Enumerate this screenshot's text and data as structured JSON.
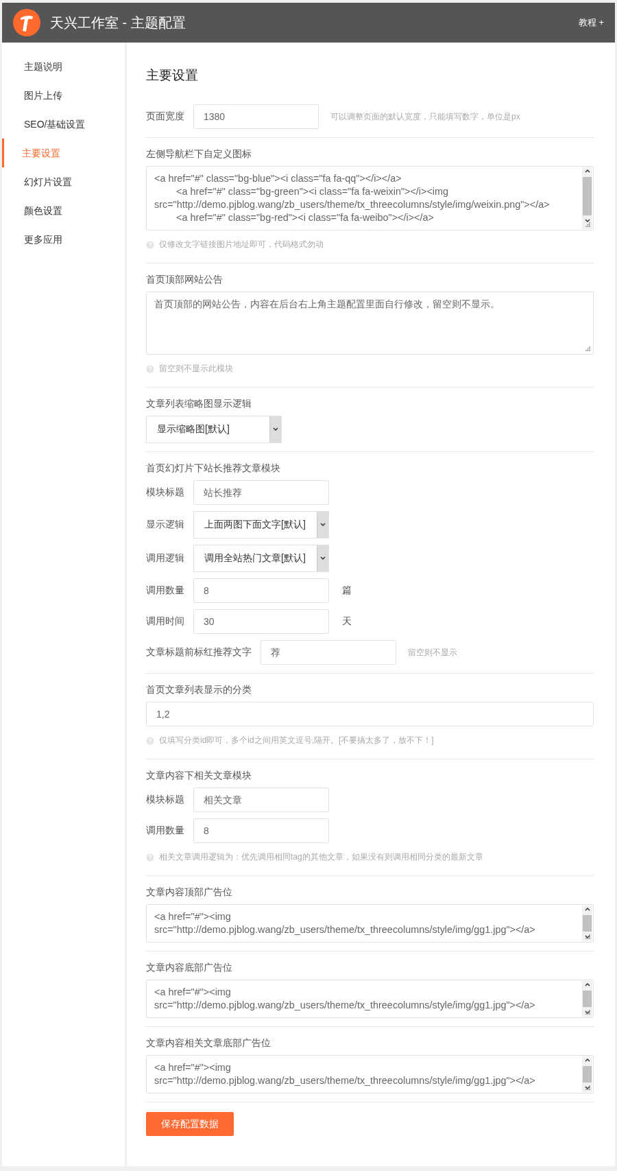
{
  "header": {
    "title": "天兴工作室 - 主题配置",
    "link": "教程 +"
  },
  "sidebar": {
    "items": [
      {
        "label": "主题说明",
        "selected": false
      },
      {
        "label": "图片上传",
        "selected": false
      },
      {
        "label": "SEO/基础设置",
        "selected": false
      },
      {
        "label": "主要设置",
        "selected": true
      },
      {
        "label": "幻灯片设置",
        "selected": false
      },
      {
        "label": "颜色设置",
        "selected": false
      },
      {
        "label": "更多应用",
        "selected": false
      }
    ]
  },
  "page_title": "主要设置",
  "sections": [
    {
      "kind": "inline",
      "label": "页面宽度",
      "value": "1380",
      "hint": "可以调整页面的默认宽度，只能填写数字，单位是px"
    },
    {
      "kind": "textarea",
      "label": "左侧导航栏下自定义图标",
      "value": "<a href=\"#\" class=\"bg-blue\"><i class=\"fa fa-qq\"></i></a>\n        <a href=\"#\" class=\"bg-green\"><i class=\"fa fa-weixin\"></i><img src=\"http://demo.pjblog.wang/zb_users/theme/tx_threecolumns/style/img/weixin.png\"></a>\n        <a href=\"#\" class=\"bg-red\"><i class=\"fa fa-weibo\"></i></a>",
      "scrollable": true,
      "help": "仅修改文字链接图片地址即可，代码格式勿动"
    },
    {
      "kind": "textarea",
      "label": "首页顶部网站公告",
      "value": "首页顶部的网站公告，内容在后台右上角主题配置里面自行修改，留空则不显示。",
      "scrollable": false,
      "help": "留空则不显示此模块"
    },
    {
      "kind": "select",
      "label": "文章列表缩略图显示逻辑",
      "value": "显示缩略图[默认]"
    },
    {
      "kind": "group",
      "label": "首页幻灯片下站长推荐文章模块",
      "rows": [
        {
          "kind": "input",
          "label": "模块标题",
          "value": "站长推荐"
        },
        {
          "kind": "select",
          "label": "显示逻辑",
          "value": "上面两图下面文字[默认]"
        },
        {
          "kind": "select",
          "label": "调用逻辑",
          "value": "调用全站热门文章[默认]"
        },
        {
          "kind": "input",
          "label": "调用数量",
          "value": "8",
          "unit": "篇"
        },
        {
          "kind": "input",
          "label": "调用时间",
          "value": "30",
          "unit": "天"
        },
        {
          "kind": "input",
          "label": "文章标题前标红推荐文字",
          "value": "荐",
          "hint": "留空则不显示"
        }
      ]
    },
    {
      "kind": "input",
      "label": "首页文章列表显示的分类",
      "value": "1,2",
      "help": "仅填写分类id即可，多个id之间用英文逗号,隔开。[不要搞太多了，放不下！]"
    },
    {
      "kind": "group",
      "label": "文章内容下相关文章模块",
      "rows": [
        {
          "kind": "input",
          "label": "模块标题",
          "value": "相关文章"
        },
        {
          "kind": "input",
          "label": "调用数量",
          "value": "8"
        }
      ],
      "help": "相关文章调用逻辑为：优先调用相同tag的其他文章，如果没有则调用相同分类的最新文章"
    },
    {
      "kind": "textarea",
      "label": "文章内容顶部广告位",
      "value": "<a href=\"#\"><img src=\"http://demo.pjblog.wang/zb_users/theme/tx_threecolumns/style/img/gg1.jpg\"></a>",
      "scrollable": true
    },
    {
      "kind": "textarea",
      "label": "文章内容底部广告位",
      "value": "<a href=\"#\"><img src=\"http://demo.pjblog.wang/zb_users/theme/tx_threecolumns/style/img/gg1.jpg\"></a>",
      "scrollable": true
    },
    {
      "kind": "textarea",
      "label": "文章内容相关文章底部广告位",
      "value": "<a href=\"#\"><img src=\"http://demo.pjblog.wang/zb_users/theme/tx_threecolumns/style/img/gg1.jpg\"></a>",
      "scrollable": true
    }
  ],
  "save_button": "保存配置数据"
}
